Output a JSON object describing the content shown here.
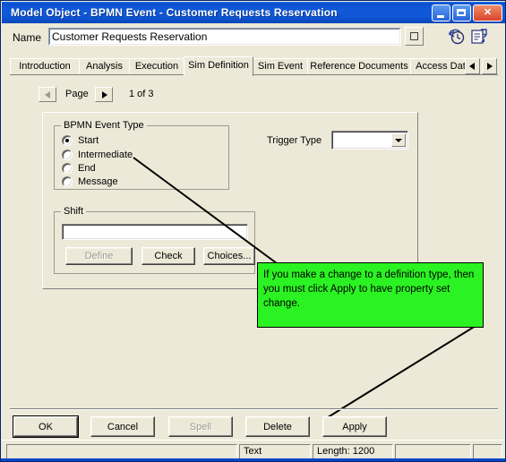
{
  "window": {
    "title": "Model Object - BPMN Event - Customer Requests Reservation",
    "controls": {
      "minimize": "minimize-button",
      "maximize": "maximize-button",
      "close": "close-button"
    }
  },
  "name_row": {
    "label": "Name",
    "value": "Customer Requests Reservation",
    "placeholder": "",
    "picker_button": "name-picker-button",
    "icons": [
      "history-clock-icon",
      "document-properties-icon"
    ]
  },
  "tabs": {
    "items": [
      {
        "label": "Introduction",
        "active": false
      },
      {
        "label": "Analysis",
        "active": false
      },
      {
        "label": "Execution",
        "active": false
      },
      {
        "label": "Sim Definition",
        "active": true
      },
      {
        "label": "Sim Event",
        "active": false
      },
      {
        "label": "Reference Documents",
        "active": false
      },
      {
        "label": "Access Data",
        "active": false
      }
    ],
    "scroll_left": "scroll-left-icon",
    "scroll_right": "scroll-right-icon"
  },
  "page_nav": {
    "prev": "page-prev-icon",
    "label": "Page",
    "next": "page-next-icon",
    "indicator": "1 of 3"
  },
  "event_type_group": {
    "title": "BPMN Event Type",
    "options": [
      {
        "label": "Start",
        "selected": true
      },
      {
        "label": "Intermediate",
        "selected": false
      },
      {
        "label": "End",
        "selected": false
      },
      {
        "label": "Message",
        "selected": false
      }
    ]
  },
  "trigger_type": {
    "label": "Trigger Type",
    "value": "",
    "dropdown_icon": "chevron-down-icon"
  },
  "shift_group": {
    "title": "Shift",
    "value": "",
    "buttons": [
      {
        "label": "Define",
        "disabled": true
      },
      {
        "label": "Check",
        "disabled": false
      },
      {
        "label": "Choices...",
        "disabled": false
      }
    ]
  },
  "annotation": {
    "text": "If you make a change to a definition type, then you must click Apply to have property set change.",
    "background": "#2BF222",
    "border": "#000000"
  },
  "footer": {
    "buttons": [
      {
        "label": "OK",
        "disabled": false,
        "default": true
      },
      {
        "label": "Cancel",
        "disabled": false,
        "default": false
      },
      {
        "label": "Spell",
        "disabled": true,
        "default": false
      },
      {
        "label": "Delete",
        "disabled": false,
        "default": false
      },
      {
        "label": "Apply",
        "disabled": false,
        "default": false
      }
    ]
  },
  "status_bar": {
    "panels": [
      "",
      "Text",
      "Length: 1200",
      "",
      ""
    ]
  },
  "colors": {
    "dialog_background": "#ECE9D8",
    "title_bar": "#0B4FCF",
    "accent_green": "#2BF222",
    "field_background": "#FFFFFF"
  }
}
